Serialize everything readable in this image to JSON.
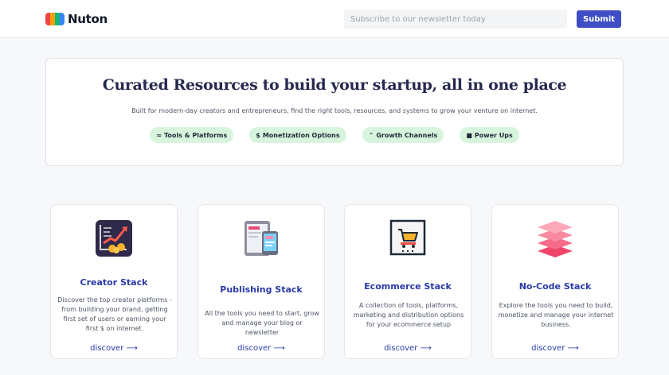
{
  "header": {
    "logo_text": "Nuton",
    "logo_colors": [
      "#ef4444",
      "#f59e0b",
      "#10b981",
      "#3b82f6"
    ],
    "newsletter": {
      "placeholder": "Subscribe to our newsletter today"
    },
    "submit_label": "Submit"
  },
  "hero": {
    "title": "Curated Resources to build your startup, all in one place",
    "subtitle": "Built for modern-day creators and entrepreneurs, find the right tools, resources, and systems to grow your venture on internet.",
    "pills": [
      {
        "glyph": "≈",
        "label": "Tools & Platforms"
      },
      {
        "glyph": "$",
        "label": "Monetization Options"
      },
      {
        "glyph": "⌃",
        "label": "Growth Channels"
      },
      {
        "glyph": "■",
        "label": "Power Ups"
      }
    ]
  },
  "cards": [
    {
      "icon": "chart-growth-icon",
      "title": "Creator Stack",
      "description": "Discover the top creator platforms - from building your brand, getting first set of users or earning your first $ on internet.",
      "link": "discover ⟶"
    },
    {
      "icon": "devices-icon",
      "title": "Publishing Stack",
      "description": "All the tools you need to start, grow and manage your blog or newsletter",
      "link": "discover ⟶"
    },
    {
      "icon": "shopping-cart-icon",
      "title": "Ecommerce Stack",
      "description": "A collection of tools, platforms, marketing and distribution options for your ecommerce setup",
      "link": "discover ⟶"
    },
    {
      "icon": "layers-icon",
      "title": "No-Code Stack",
      "description": "Explore the tools you need to build, monetize and manage your internet business.",
      "link": "discover ⟶"
    }
  ],
  "colors": {
    "accent": "#3f4ec5",
    "link": "#2a3aa8",
    "pill_bg": "#d7f5dd",
    "hero_title": "#262a4f"
  }
}
